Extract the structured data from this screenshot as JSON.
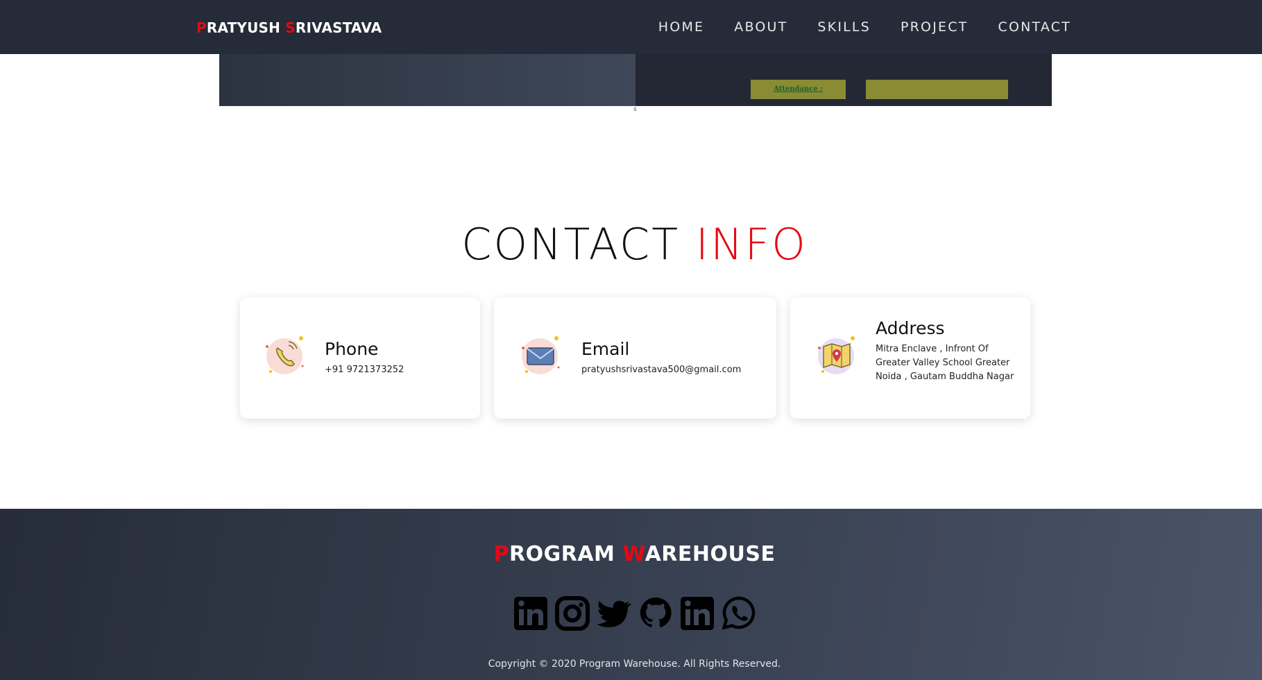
{
  "navbar": {
    "brand_first_initial": "P",
    "brand_first_rest": "RATYUSH ",
    "brand_last_initial": "S",
    "brand_last_rest": "RIVASTAVA",
    "links": [
      "HOME",
      "ABOUT",
      "SKILLS",
      "PROJECT",
      "CONTACT"
    ]
  },
  "project": {
    "attendance_label": "Attendance :",
    "tiny_text": "s"
  },
  "contact": {
    "title_part1": "CONTACT ",
    "title_part2": "INFO",
    "cards": [
      {
        "icon": "phone-icon",
        "title": "Phone",
        "text": "+91 9721373252"
      },
      {
        "icon": "email-icon",
        "title": "Email",
        "text": "pratyushsrivastava500@gmail.com"
      },
      {
        "icon": "map-icon",
        "title": "Address",
        "text": "Mitra Enclave , Infront Of Greater Valley School Greater Noida , Gautam Buddha Nagar"
      }
    ]
  },
  "footer": {
    "title_first_initial": "P",
    "title_first_rest": "ROGRAM ",
    "title_second_initial": "W",
    "title_second_rest": "AREHOUSE",
    "socials": [
      "linkedin-icon",
      "instagram-icon",
      "twitter-icon",
      "github-icon",
      "linkedin-icon",
      "whatsapp-icon"
    ],
    "copyright": "Copyright © 2020 Program Warehouse. All Rights Reserved."
  },
  "colors": {
    "accent": "#e50914",
    "navbar_bg": "#252b38",
    "footer_bg": "#3a4354",
    "attendance_bg": "#8a8b35"
  }
}
